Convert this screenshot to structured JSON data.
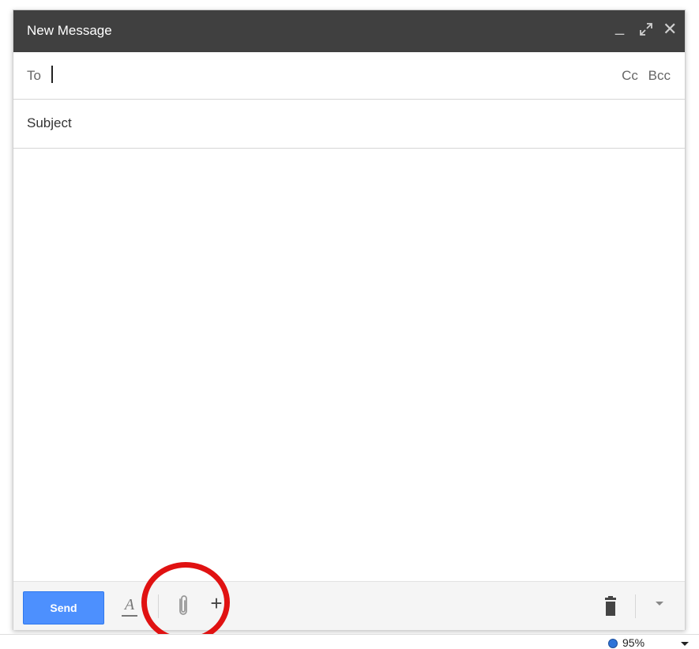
{
  "background": {
    "top_text": "",
    "top_right_text": "",
    "left_marks": []
  },
  "compose": {
    "title": "New Message",
    "window_controls": {
      "minimize": "_",
      "close": "✕"
    },
    "to_label": "To",
    "cc_label": "Cc",
    "bcc_label": "Bcc",
    "subject_placeholder": "Subject"
  },
  "toolbar": {
    "send_label": "Send",
    "format_glyph": "A",
    "plus_glyph": "+",
    "colors": {
      "send_bg": "#4d90fe",
      "annotation": "#e01212"
    }
  },
  "status": {
    "zoom": "95%"
  }
}
